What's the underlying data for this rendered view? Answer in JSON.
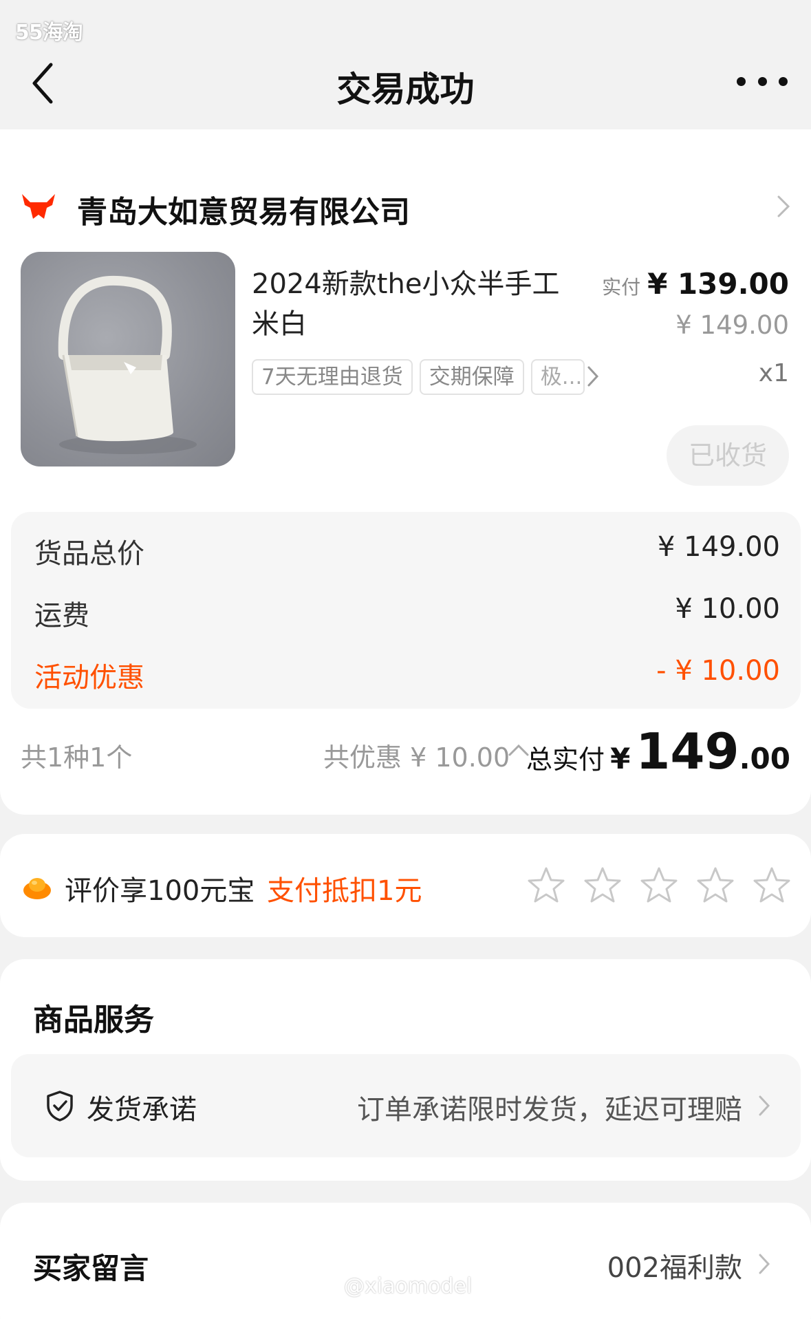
{
  "watermark_top": "55海淘",
  "watermark_bottom": "@xiaomodel",
  "nav": {
    "title": "交易成功"
  },
  "shop": {
    "name": "青岛大如意贸易有限公司"
  },
  "product": {
    "title": "2024新款the小众半手工米白",
    "tags": [
      "7天无理由退货",
      "交期保障",
      "极..."
    ],
    "paid_label": "实付",
    "paid_price": "¥ 139.00",
    "original_price": "¥ 149.00",
    "quantity": "x1",
    "status_button": "已收货"
  },
  "fees": {
    "goods_total_label": "货品总价",
    "goods_total_value": "¥ 149.00",
    "shipping_label": "运费",
    "shipping_value": "¥ 10.00",
    "discount_label": "活动优惠",
    "discount_value": "- ¥ 10.00"
  },
  "summary": {
    "count": "共1种1个",
    "saving": "共优惠 ¥ 10.00",
    "total_label": "总实付",
    "total_yen": "¥",
    "total_int": "149",
    "total_dec": ".00"
  },
  "review": {
    "text": "评价享100元宝",
    "promo": "支付抵扣1元",
    "stars": 0
  },
  "service": {
    "title": "商品服务",
    "item_name": "发货承诺",
    "item_desc": "订单承诺限时发货，延迟可理赔"
  },
  "message": {
    "title": "买家留言",
    "value": "002福利款"
  },
  "colors": {
    "accent": "#ff5000",
    "brand": "#ff2a00"
  }
}
